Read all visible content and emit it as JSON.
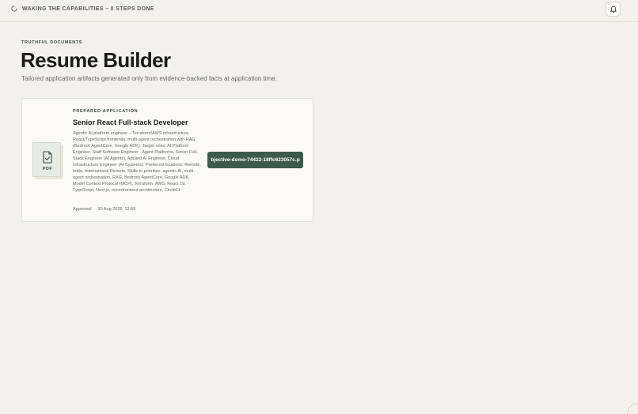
{
  "status": {
    "text": "WAKING THE CAPABILITIES – 0 STEPS DONE",
    "icon": "spinner-icon"
  },
  "header": {
    "notification_icon": "bell-icon"
  },
  "page": {
    "eyebrow": "TRUTHFUL DOCUMENTS",
    "title": "Resume Builder",
    "subtitle": "Tailored application artifacts generated only from evidence-backed facts at application time."
  },
  "card": {
    "file_type": "PDF",
    "file_icon": "document-check-icon",
    "eyebrow": "PREPARED APPLICATION",
    "title": "Senior React Full-stack Developer",
    "description": "Agentic AI platform engineer – Terraform/AWS infrastructure, React/TypeScript frontends, multi-agent orchestration with RAG (Bedrock AgentCore, Google ADK). Target roles: AI Platform Engineer, Staff Software Engineer · Agent Platforms, Senior Full-Stack Engineer (AI Agents), Applied AI Engineer, Cloud Infrastructure Engineer (AI Systems). Preferred locations: Remote, India, International Remote. Skills to prioritize: agentic AI, multi-agent orchestration, RAG, Bedrock AgentCore, Google ADK, Model Context Protocol (MCP), Terraform, AWS, React 19, TypeScript, Next.js, microfrontend architecture, CircleCI",
    "status": "Approved",
    "date": "30 Aug 2026, 12:59",
    "file_button_label": "bjective-demo-74422-18ffc623057c.p"
  },
  "colors": {
    "background": "#f3f1eb",
    "card": "#fbfaf7",
    "accent": "#3d5a4a"
  }
}
